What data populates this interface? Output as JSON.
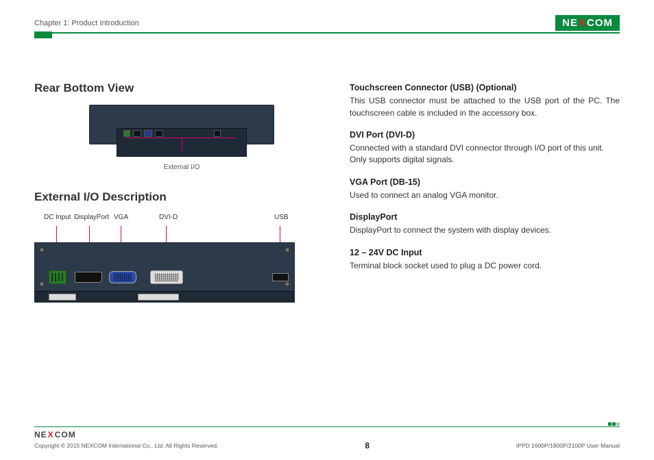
{
  "header": {
    "chapter": "Chapter 1: Product Introduction",
    "brand_before": "NE",
    "brand_x": "X",
    "brand_after": "COM"
  },
  "left": {
    "heading1": "Rear Bottom View",
    "fig1_caption": "External I/O",
    "heading2": "External I/O Description",
    "labels": {
      "dc": "DC Input",
      "dp": "DisplayPort",
      "vga": "VGA",
      "dvi": "DVI-D",
      "usb": "USB"
    }
  },
  "right": {
    "sections": [
      {
        "title": "Touchscreen Connector (USB) (Optional)",
        "body": "This USB connector must be attached to the USB port of the PC. The touchscreen cable is included in the accessory box.",
        "justify": true
      },
      {
        "title": "DVI Port (DVI-D)",
        "body": "Connected with a standard DVI connector through I/O port of this unit. Only supports digital signals.",
        "justify": false
      },
      {
        "title": "VGA Port (DB-15)",
        "body": "Used to connect an analog VGA monitor.",
        "justify": false
      },
      {
        "title": "DisplayPort",
        "body": "DisplayPort to connect the system with display devices.",
        "justify": false
      },
      {
        "title": "12 – 24V DC Input",
        "body": "Terminal block socket used to plug a DC power cord.",
        "justify": false
      }
    ]
  },
  "footer": {
    "brand_before": "NE",
    "brand_x": "X",
    "brand_after": "COM",
    "copyright": "Copyright © 2015 NEXCOM International Co., Ltd. All Rights Reserved.",
    "page": "8",
    "doc": "IPPD 1600P/1800P/2100P User Manual"
  }
}
